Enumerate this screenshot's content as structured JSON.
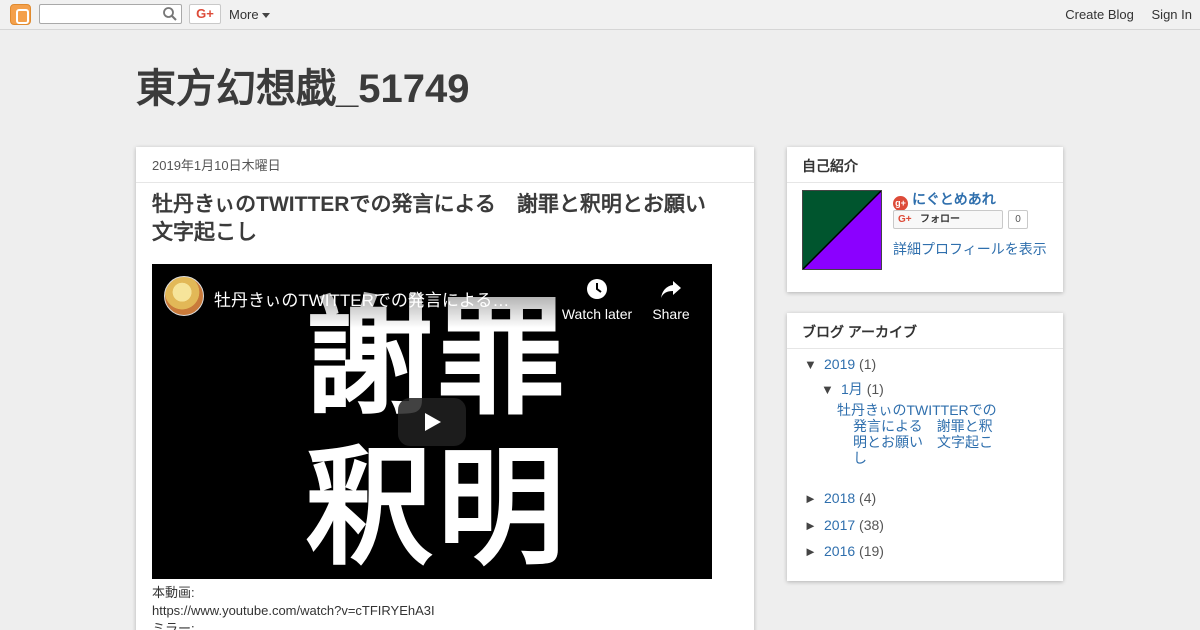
{
  "navbar": {
    "more_label": "More",
    "create_blog": "Create Blog",
    "sign_in": "Sign In",
    "gplus_label": "G+"
  },
  "blog": {
    "title": "東方幻想戯_51749"
  },
  "post": {
    "date": "2019年1月10日木曜日",
    "title": "牡丹きぃのTWITTERでの発言による　謝罪と釈明とお願い　文字起こし",
    "video": {
      "title": "牡丹きぃのTWITTERでの発言による…",
      "thumbnail_text": "謝罪釈明",
      "watch_later": "Watch later",
      "share": "Share"
    },
    "body": [
      "本動画:",
      "https://www.youtube.com/watch?v=cTFIRYEhA3I",
      "ミラー:"
    ]
  },
  "sidebar": {
    "profile": {
      "heading": "自己紹介",
      "name": "にぐとめあれ",
      "follow_label": "フォロー",
      "follow_count": "0",
      "view_profile": "詳細プロフィールを表示",
      "avatar_colors": [
        "#00552e",
        "#8b00ff"
      ]
    },
    "archive": {
      "heading": "ブログ アーカイブ",
      "years": [
        {
          "year": "2019",
          "count": "(1)",
          "expanded": true
        },
        {
          "year": "2018",
          "count": "(4)",
          "expanded": false
        },
        {
          "year": "2017",
          "count": "(38)",
          "expanded": false
        },
        {
          "year": "2016",
          "count": "(19)",
          "expanded": false
        }
      ],
      "month": {
        "label": "1月",
        "count": "(1)"
      },
      "post_link": "牡丹きぃのTWITTERでの発言による　謝罪と釈明とお願い　文字起こし"
    }
  },
  "colors": {
    "link": "#2f6fad",
    "background": "#eeeeee"
  }
}
